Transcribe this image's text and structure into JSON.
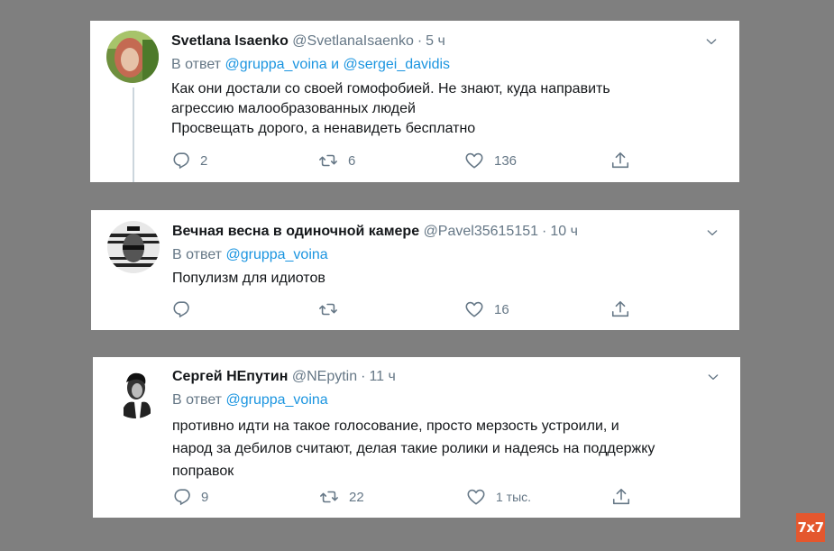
{
  "tweets": [
    {
      "name": "Svetlana Isaenko",
      "handle": "@SvetlanaIsaenko",
      "time": "5 ч",
      "reply_prefix": "В ответ",
      "mention1": "@gruppa_voina",
      "mention_and": "и",
      "mention2": "@sergei_davidis",
      "lines": [
        "Как они достали со своей гомофобией. Не знают, куда направить",
        "агрессию малообразованных людей",
        "Просвещать дорого, а ненавидеть бесплатно"
      ],
      "replies": "2",
      "retweets": "6",
      "likes": "136"
    },
    {
      "name": "Вечная весна в одиночной камере",
      "handle": "@Pavel35615151",
      "time": "10 ч",
      "reply_prefix": "В ответ",
      "mention1": "@gruppa_voina",
      "lines": [
        "Популизм для идиотов"
      ],
      "replies": "",
      "retweets": "",
      "likes": "16"
    },
    {
      "name": "Сергей НЕпутин",
      "handle": "@NEpytin",
      "time": "11 ч",
      "reply_prefix": "В ответ",
      "mention1": "@gruppa_voina",
      "lines": [
        "противно идти на такое голосование, просто мерзость устроили, и",
        "народ за дебилов считают, делая такие ролики и надеясь на поддержку",
        "поправок"
      ],
      "replies": "9",
      "retweets": "22",
      "likes": "1 тыс."
    }
  ],
  "separator": "·",
  "watermark": "7x7",
  "icons": {
    "reply": "reply-icon",
    "retweet": "retweet-icon",
    "like": "like-icon",
    "share": "share-icon",
    "caret": "chevron-down-icon"
  },
  "colors": {
    "background": "#7f7f7f",
    "card": "#ffffff",
    "mention": "#1b95e0",
    "muted": "#657786",
    "watermark": "#e4572e"
  }
}
